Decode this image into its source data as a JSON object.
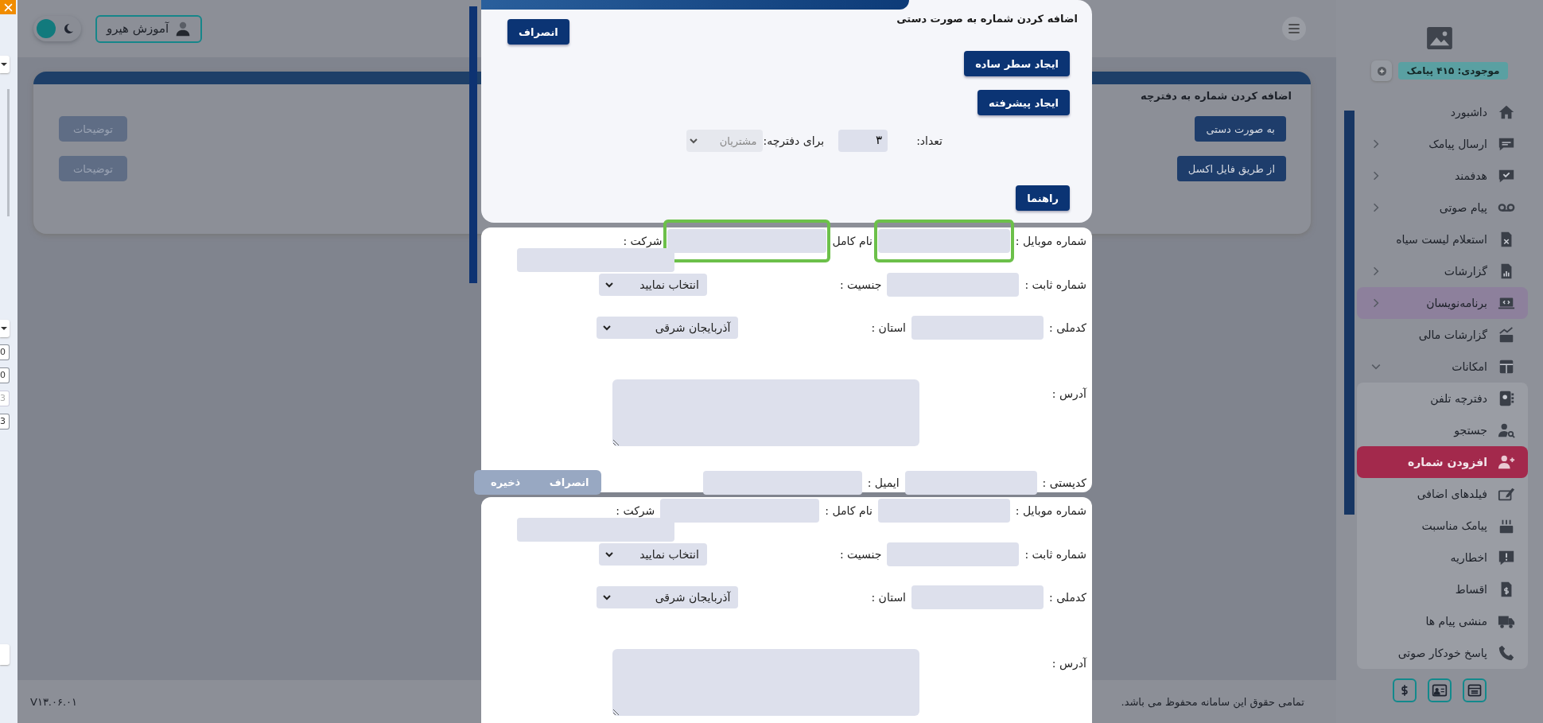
{
  "left_panel": {
    "values": [
      {
        "text": "0",
        "disabled": false
      },
      {
        "text": "0",
        "disabled": false
      },
      {
        "text": "3",
        "disabled": true
      },
      {
        "text": "3",
        "disabled": false
      }
    ]
  },
  "header": {
    "user_button": "آموزش هیرو",
    "dark_mode": false
  },
  "page_card": {
    "title": "اضافه کردن شماره به دفترچه",
    "actions": [
      {
        "label": "به صورت دستی",
        "description": "توضیحات"
      },
      {
        "label": "از طریق فایل اکسل",
        "description": "توضیحات"
      }
    ]
  },
  "footer": {
    "version": "V۱۳.۰۶.۰۱",
    "copyright": "تمامی حقوق این سامانه محفوظ می باشد."
  },
  "sidebar": {
    "balance": "موجودی: ۴۱۵ پیامک",
    "items": [
      {
        "label": "داشبورد",
        "submenu": false,
        "selected": false,
        "hovered": false
      },
      {
        "label": "ارسال پیامک",
        "submenu": true,
        "expanded": false,
        "selected": false,
        "hovered": false
      },
      {
        "label": "هدفمند",
        "submenu": true,
        "expanded": false,
        "selected": false,
        "hovered": false
      },
      {
        "label": "پیام صوتی",
        "submenu": true,
        "expanded": false,
        "selected": false,
        "hovered": false
      },
      {
        "label": "استعلام لیست سیاه",
        "submenu": false,
        "selected": false,
        "hovered": false
      },
      {
        "label": "گزارشات",
        "submenu": true,
        "expanded": false,
        "selected": false,
        "hovered": false
      },
      {
        "label": "برنامه‌نویسان",
        "submenu": true,
        "expanded": false,
        "selected": false,
        "hovered": true
      },
      {
        "label": "گزارشات مالی",
        "submenu": false,
        "selected": false,
        "hovered": false
      },
      {
        "label": "امکانات",
        "submenu": true,
        "expanded": true,
        "selected": false,
        "hovered": false,
        "children": [
          {
            "label": "دفترچه تلفن",
            "selected": false
          },
          {
            "label": "جستجو",
            "selected": false
          },
          {
            "label": "افزودن شماره",
            "selected": true
          },
          {
            "label": "فیلدهای اضافی",
            "selected": false
          },
          {
            "label": "پیامک مناسبت",
            "selected": false
          },
          {
            "label": "اخطاریه",
            "selected": false
          },
          {
            "label": "اقساط",
            "selected": false
          },
          {
            "label": "منشی پیام ها",
            "selected": false
          },
          {
            "label": "پاسخ خودکار صوتی",
            "selected": false
          }
        ]
      }
    ]
  },
  "modal": {
    "title": "اضافه کردن شماره به صورت دستی",
    "cancel": "انصراف",
    "buttons": [
      "ایجاد سطر ساده",
      "ایجاد پیشرفته"
    ],
    "count_label": "تعداد:",
    "count": "۳",
    "phonebook_label": "برای دفترچه:",
    "phonebook": {
      "value": "مشتریان",
      "disabled": true
    },
    "help": "راهنما"
  },
  "forms": [
    {
      "fields": [
        {
          "label": "شماره موبایل :",
          "kind": "text",
          "highlighted": true
        },
        {
          "label": "نام کامل",
          "kind": "text",
          "highlighted": true
        },
        {
          "label": "شرکت :",
          "kind": "text",
          "highlighted": false
        },
        {
          "label": "شماره ثابت :",
          "kind": "text",
          "highlighted": false
        },
        {
          "label": "جنسیت :",
          "kind": "select",
          "value": "انتخاب نمایید",
          "highlighted": false
        },
        {
          "label": "کدملی :",
          "kind": "text",
          "highlighted": false
        },
        {
          "label": "استان :",
          "kind": "select",
          "value": "آذربایجان شرقی",
          "highlighted": false
        },
        {
          "label": "آدرس :",
          "kind": "textarea",
          "highlighted": false
        },
        {
          "label": "کدپستی :",
          "kind": "text",
          "highlighted": false
        },
        {
          "label": "ایمیل :",
          "kind": "text",
          "highlighted": false
        }
      ],
      "buttons": [
        "انصراف",
        "ذخیره"
      ]
    },
    {
      "fields": [
        {
          "label": "شماره موبایل :",
          "kind": "text",
          "highlighted": false
        },
        {
          "label": "نام کامل :",
          "kind": "text",
          "highlighted": false
        },
        {
          "label": "شرکت :",
          "kind": "text",
          "highlighted": false
        },
        {
          "label": "شماره ثابت :",
          "kind": "text",
          "highlighted": false
        },
        {
          "label": "جنسیت :",
          "kind": "select",
          "value": "انتخاب نمایید",
          "highlighted": false
        },
        {
          "label": "کدملی :",
          "kind": "text",
          "highlighted": false
        },
        {
          "label": "استان :",
          "kind": "select",
          "value": "آذربایجان شرقی",
          "highlighted": false
        },
        {
          "label": "آدرس :",
          "kind": "textarea",
          "highlighted": false
        }
      ]
    }
  ]
}
